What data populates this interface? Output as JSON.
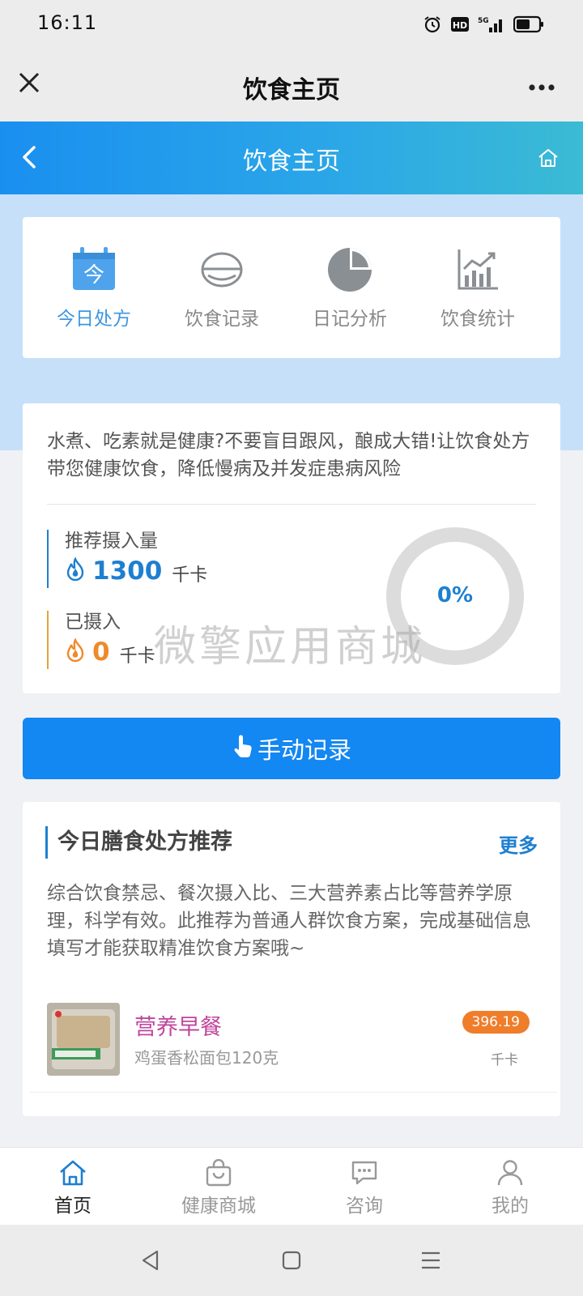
{
  "status_bar": {
    "time": "16:11",
    "hd_badge": "HD",
    "network": "5G"
  },
  "wechat_bar": {
    "title": "饮食主页",
    "more_label": "···"
  },
  "app_header": {
    "title": "饮食主页"
  },
  "nav_items": [
    {
      "label": "今日处方",
      "icon": "calendar-today-icon",
      "active": true,
      "badge": "今"
    },
    {
      "label": "饮食记录",
      "icon": "bowl-icon",
      "active": false
    },
    {
      "label": "日记分析",
      "icon": "pie-chart-icon",
      "active": false
    },
    {
      "label": "饮食统计",
      "icon": "line-chart-icon",
      "active": false
    }
  ],
  "intake": {
    "intro": "水煮、吃素就是健康?不要盲目跟风，酿成大错!让饮食处方带您健康饮食，降低慢病及并发症患病风险",
    "recommended": {
      "label": "推荐摄入量",
      "value": "1300",
      "unit": "千卡"
    },
    "consumed": {
      "label": "已摄入",
      "value": "0",
      "unit": "千卡"
    },
    "progress_text": "0%",
    "progress_fraction": 0
  },
  "watermark": "微擎应用商城",
  "record_button": {
    "label": "手动记录"
  },
  "recommendation": {
    "title": "今日膳食处方推荐",
    "more": "更多",
    "description": "综合饮食禁忌、餐次摄入比、三大营养素占比等营养学原理，科学有效。此推荐为普通人群饮食方案，完成基础信息填写才能获取精准饮食方案哦~",
    "meals": [
      {
        "name": "营养早餐",
        "detail": "鸡蛋香松面包120克",
        "calories": "396.19",
        "unit": "千卡"
      }
    ]
  },
  "bottom_tabs": [
    {
      "label": "首页",
      "icon": "home-icon",
      "active": true
    },
    {
      "label": "健康商城",
      "icon": "shopping-bag-icon",
      "active": false
    },
    {
      "label": "咨询",
      "icon": "chat-icon",
      "active": false
    },
    {
      "label": "我的",
      "icon": "user-icon",
      "active": false
    }
  ],
  "colors": {
    "primary": "#1387f2",
    "accent_orange": "#ef7d2a",
    "meal_name": "#c0459c",
    "header_gradient_start": "#1a8ff0",
    "header_gradient_end": "#3bbbd4"
  }
}
